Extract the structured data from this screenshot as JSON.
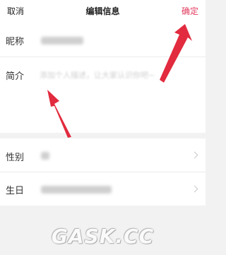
{
  "nav": {
    "cancel_label": "取消",
    "title": "编辑信息",
    "confirm_label": "确定",
    "confirm_color": "#e23a5e"
  },
  "form": {
    "nickname_label": "昵称",
    "intro_label": "简介",
    "intro_placeholder": "添加个人描述，让大家认识你吧~",
    "gender_label": "性别",
    "birthday_label": "生日"
  },
  "annotations": {
    "arrow_color": "#e0192e",
    "arrow_count": 2
  },
  "watermark": {
    "text": "GASK.CC"
  },
  "icons": {
    "chevron": "chevron-right-icon"
  }
}
